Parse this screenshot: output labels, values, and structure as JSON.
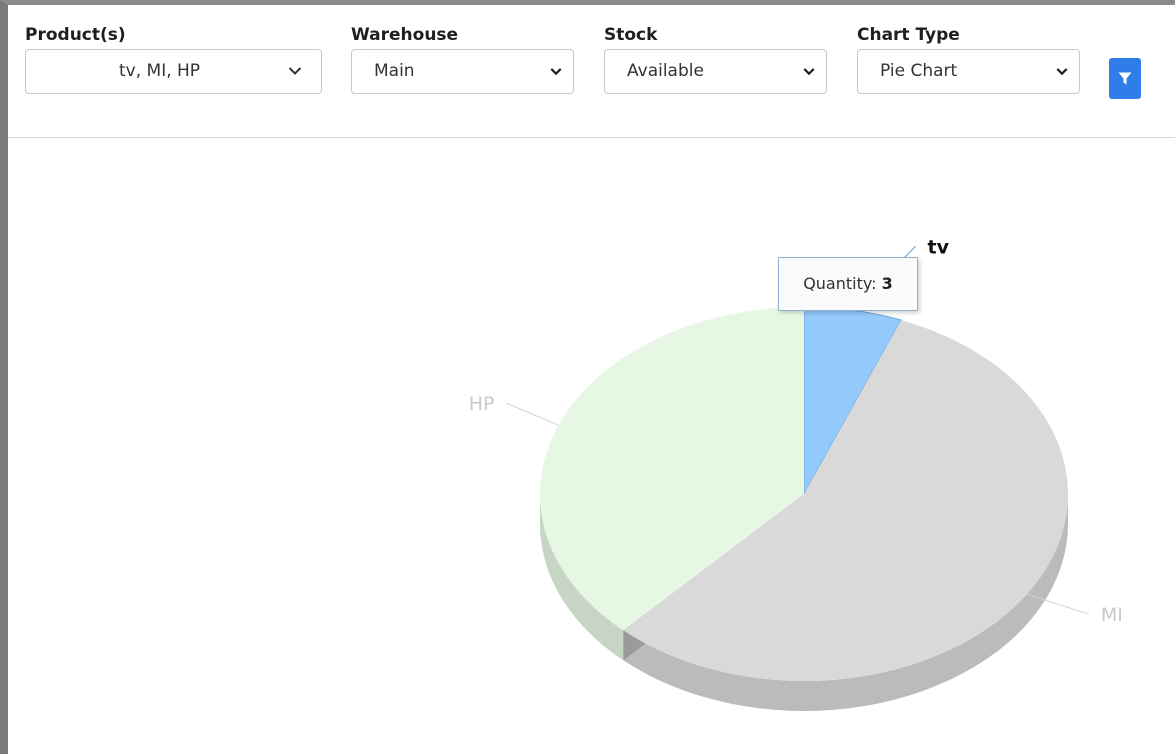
{
  "filters": {
    "product": {
      "label": "Product(s)",
      "value": "tv, MI, HP"
    },
    "warehouse": {
      "label": "Warehouse",
      "value": "Main"
    },
    "stock": {
      "label": "Stock",
      "value": "Available"
    },
    "chart_type": {
      "label": "Chart Type",
      "value": "Pie Chart"
    },
    "filter_button_icon": "filter-icon",
    "accent_color": "#2f7de8"
  },
  "tooltip": {
    "label": "Quantity:",
    "value": "3"
  },
  "chart_data": {
    "type": "pie",
    "title": "",
    "style": "3d",
    "slices": [
      {
        "label": "tv",
        "value": 3,
        "color": "#93c9fb",
        "highlighted": true
      },
      {
        "label": "MI",
        "value": 28,
        "color": "#d9d9d9",
        "highlighted": false
      },
      {
        "label": "HP",
        "value": 19,
        "color": "#e6f8e4",
        "highlighted": false
      }
    ]
  }
}
